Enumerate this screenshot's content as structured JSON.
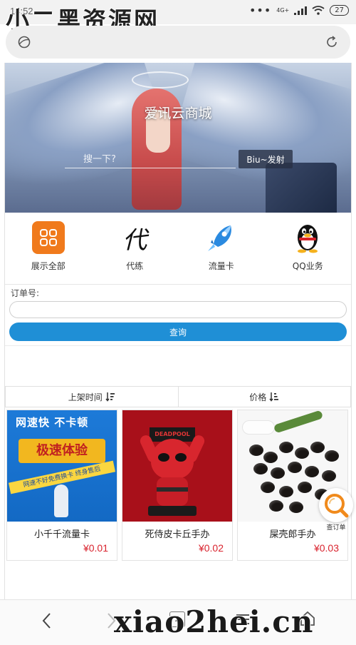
{
  "status_bar": {
    "time": "14:52",
    "network": "4G+",
    "battery": "27"
  },
  "watermark": {
    "top": "小二黑资源网",
    "bottom": "xiao2hei.cn"
  },
  "banner": {
    "title": "爱讯云商城",
    "search_placeholder": "搜一下?",
    "search_button": "Biu~发射"
  },
  "categories": [
    {
      "label": "展示全部",
      "icon": "grid-icon",
      "color": "#f07a1c"
    },
    {
      "label": "代练",
      "icon": "calligraphy-dai-icon",
      "glyph": "代"
    },
    {
      "label": "流量卡",
      "icon": "rocket-icon",
      "color": "#2a8ae0"
    },
    {
      "label": "QQ业务",
      "icon": "qq-penguin-icon"
    }
  ],
  "order": {
    "label": "订单号:",
    "input_value": "",
    "query_button": "查询",
    "accent": "#1f8fd6"
  },
  "sort": {
    "time_label": "上架时间",
    "price_label": "价格"
  },
  "products": [
    {
      "name": "小千千流量卡",
      "price": "¥0.01",
      "image": {
        "line1": "网速快 不卡顿",
        "line2": "极速体验",
        "line3": "网速不好免费换卡 终身售后"
      }
    },
    {
      "name": "死侍皮卡丘手办",
      "price": "¥0.02",
      "image": {
        "sign": "DEADPOOL"
      }
    },
    {
      "name": "屎壳郎手办",
      "price": "¥0.03"
    }
  ],
  "float_button": {
    "label": "查订单"
  },
  "bottom_nav": {
    "tab_count": "2"
  },
  "colors": {
    "price": "#d9232e",
    "primary": "#1f8fd6"
  }
}
